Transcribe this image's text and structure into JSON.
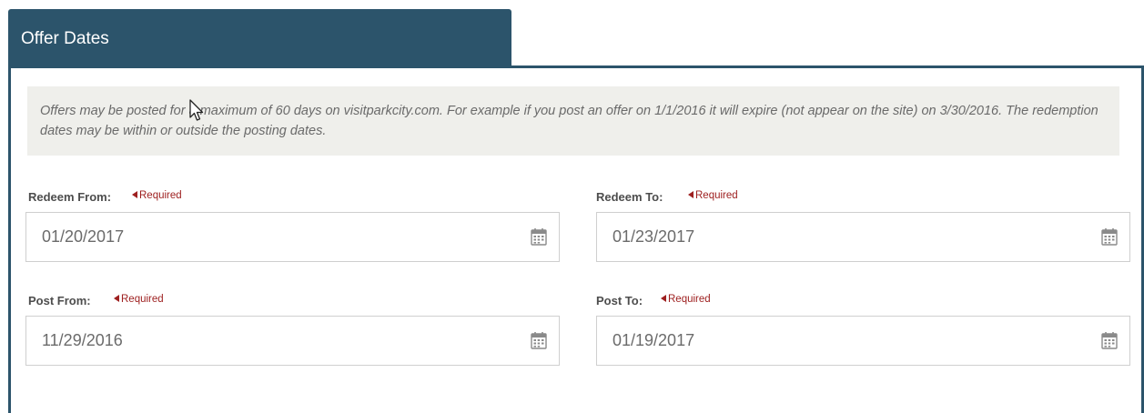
{
  "section": {
    "title": "Offer Dates"
  },
  "note": {
    "text": "Offers may be posted for a maximum of 60 days on visitparkcity.com. For example if you post an offer on 1/1/2016 it will expire (not appear on the site) on 3/30/2016. The redemption dates may be within or outside the posting dates."
  },
  "fields": {
    "redeem_from": {
      "label": "Redeem From:",
      "required": "Required",
      "value": "01/20/2017"
    },
    "redeem_to": {
      "label": "Redeem To:",
      "required": "Required",
      "value": "01/23/2017"
    },
    "post_from": {
      "label": "Post From:",
      "required": "Required",
      "value": "11/29/2016"
    },
    "post_to": {
      "label": "Post To:",
      "required": "Required",
      "value": "01/19/2017"
    }
  },
  "icons": {
    "calendar": "calendar-icon",
    "required_marker": "triangle-left-icon",
    "cursor": "mouse-cursor-icon"
  },
  "colors": {
    "header": "#2c546b",
    "required": "#9e2020",
    "note_bg": "#efefeb"
  }
}
